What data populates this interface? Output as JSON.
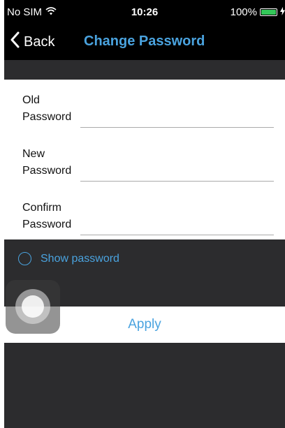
{
  "status_bar": {
    "carrier": "No SIM",
    "wifi_icon": "wifi-icon",
    "time": "10:26",
    "battery_percent": "100%",
    "battery_level": 1.0,
    "battery_color": "#34c759"
  },
  "nav": {
    "back_label": "Back",
    "back_icon": "chevron-left-icon",
    "title": "Change Password"
  },
  "form": {
    "fields": [
      {
        "label": "Old Password",
        "value": ""
      },
      {
        "label": "New Password",
        "value": ""
      },
      {
        "label": "Confirm Password",
        "value": ""
      }
    ],
    "show_password_label": "Show password",
    "show_password_checked": false
  },
  "apply": {
    "label": "Apply"
  },
  "colors": {
    "accent": "#4aa3df",
    "background": "#2c2c2e",
    "bar": "#000000"
  }
}
